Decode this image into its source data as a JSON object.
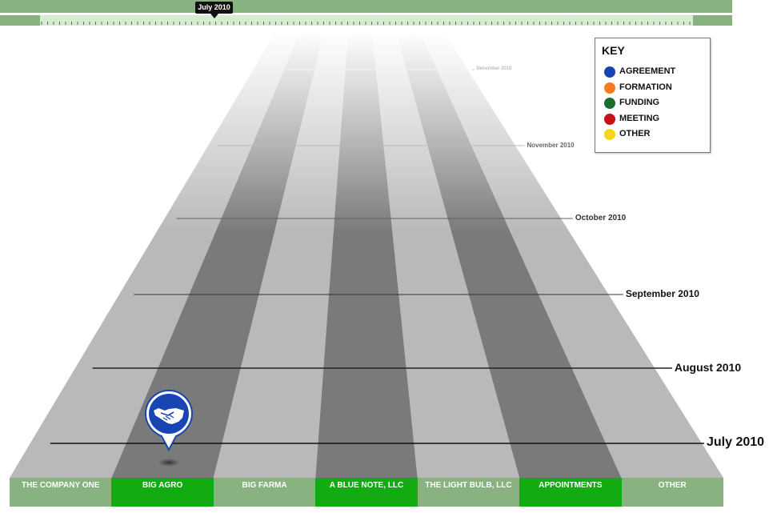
{
  "scrubber": {
    "current_date": "July 2010"
  },
  "months": [
    {
      "label": "July 2010",
      "size": 16,
      "color": "#111111"
    },
    {
      "label": "August 2010",
      "size": 14,
      "color": "#111111"
    },
    {
      "label": "September 2010",
      "size": 12,
      "color": "#111111"
    },
    {
      "label": "October 2010",
      "size": 10,
      "color": "#333333"
    },
    {
      "label": "November 2010",
      "size": 8,
      "color": "#666666"
    },
    {
      "label": "December 2010",
      "size": 6,
      "color": "#bbbbbb"
    }
  ],
  "key": {
    "title": "KEY",
    "items": [
      {
        "label": "AGREEMENT",
        "color": "#1845b4"
      },
      {
        "label": "FORMATION",
        "color": "#f47c1e"
      },
      {
        "label": "FUNDING",
        "color": "#1b6e2e"
      },
      {
        "label": "MEETING",
        "color": "#c8101a"
      },
      {
        "label": "OTHER",
        "color": "#f6d51c"
      }
    ]
  },
  "lanes": [
    {
      "label": "THE COMPANY ONE",
      "highlighted": false
    },
    {
      "label": "BIG AGRO",
      "highlighted": true
    },
    {
      "label": "BIG FARMA",
      "highlighted": false
    },
    {
      "label": "A BLUE NOTE, LLC",
      "highlighted": true
    },
    {
      "label": "THE LIGHT BULB, LLC",
      "highlighted": false
    },
    {
      "label": "APPOINTMENTS",
      "highlighted": true
    },
    {
      "label": "OTHER",
      "highlighted": false
    }
  ],
  "colors": {
    "lane_light": "#b9b9b9",
    "lane_dark": "#7a7a7a",
    "label_green": "#12ab12",
    "label_sage": "#88b27f",
    "agreement_blue": "#1845b4"
  },
  "events": [
    {
      "lane": "BIG AGRO",
      "type": "AGREEMENT",
      "icon": "handshake-icon",
      "date": "July 2010"
    }
  ]
}
